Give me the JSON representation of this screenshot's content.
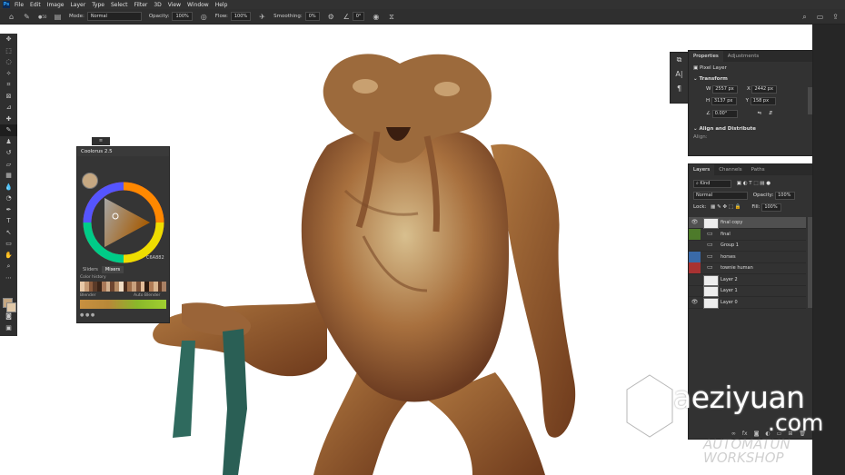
{
  "menubar": {
    "app_icon": "Ps",
    "items": [
      "File",
      "Edit",
      "Image",
      "Layer",
      "Type",
      "Select",
      "Filter",
      "3D",
      "View",
      "Window",
      "Help"
    ]
  },
  "options_bar": {
    "mode_label": "Mode:",
    "mode_value": "Normal",
    "opacity_label": "Opacity:",
    "opacity_value": "100%",
    "flow_label": "Flow:",
    "flow_value": "100%",
    "smoothing_label": "Smoothing:",
    "smoothing_value": "0%",
    "angle_value": "0°",
    "brush_size": "50"
  },
  "color_panel": {
    "title": "Coolorus 2.5",
    "hex": "C6A882",
    "tabs": [
      "Sliders",
      "Mixers"
    ],
    "selected_tab": "Mixers",
    "color_history_label": "Color history",
    "blender_label": "Blender",
    "auto_label": "Auto Blender",
    "fg_color": "#c6a882",
    "history_colors": [
      "#e8c9a8",
      "#c69a74",
      "#8a5a3c",
      "#5a3a28",
      "#3a2418",
      "#a87858",
      "#d2b190",
      "#6e4630",
      "#b48a64",
      "#f0dcc4",
      "#4a2c1c",
      "#9c6c48",
      "#c8a07c",
      "#7a5036",
      "#e2bc98",
      "#2c1a10",
      "#b07c56",
      "#d8b48e",
      "#5e3a26",
      "#a88064"
    ]
  },
  "properties_panel": {
    "tabs": [
      "Properties",
      "Adjustments"
    ],
    "kind": "Pixel Layer",
    "transform_label": "Transform",
    "w_label": "W",
    "w_value": "2557 px",
    "x_label": "X",
    "x_value": "2442 px",
    "h_label": "H",
    "h_value": "3137 px",
    "y_label": "Y",
    "y_value": "158 px",
    "angle_value": "0.00°",
    "align_label": "Align and Distribute",
    "align_sub": "Align:"
  },
  "layers_panel": {
    "tabs": [
      "Layers",
      "Channels",
      "Paths"
    ],
    "kind_filter": "Kind",
    "blend_mode": "Normal",
    "opacity_label": "Opacity:",
    "opacity_value": "100%",
    "lock_label": "Lock:",
    "fill_label": "Fill:",
    "fill_value": "100%",
    "layers": [
      {
        "name": "final copy",
        "type": "pixel",
        "visible": true,
        "selected": true,
        "tag": ""
      },
      {
        "name": "final",
        "type": "group",
        "visible": false,
        "selected": false,
        "tag": "#4d7a2a"
      },
      {
        "name": "Group 1",
        "type": "group",
        "visible": false,
        "selected": false,
        "tag": ""
      },
      {
        "name": "horses",
        "type": "group",
        "visible": false,
        "selected": false,
        "tag": "#3a6aa8"
      },
      {
        "name": "townie human",
        "type": "group",
        "visible": false,
        "selected": false,
        "tag": "#a83232"
      },
      {
        "name": "Layer 2",
        "type": "pixel",
        "visible": false,
        "selected": false,
        "tag": ""
      },
      {
        "name": "Layer 1",
        "type": "pixel",
        "visible": false,
        "selected": false,
        "tag": ""
      },
      {
        "name": "Layer 0",
        "type": "pixel",
        "visible": true,
        "selected": false,
        "tag": ""
      }
    ],
    "footer_icons": [
      "fx-icon",
      "mask-icon",
      "adjustment-icon",
      "folder-icon",
      "new-layer-icon",
      "trash-icon"
    ]
  },
  "watermark": {
    "text": "aeziyuan",
    "domain": ".com",
    "faint": "AUTOMATUN WORKSHOP"
  }
}
